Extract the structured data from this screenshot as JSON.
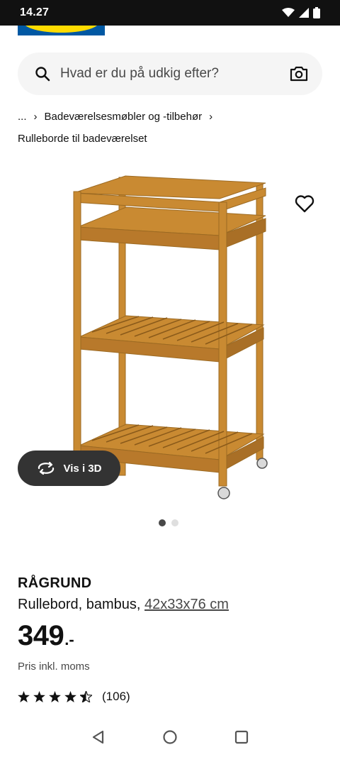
{
  "status_bar": {
    "time": "14.27"
  },
  "brand": {
    "blue": "#0058a3",
    "yellow": "#ffdb00"
  },
  "search": {
    "placeholder": "Hvad er du på udkig efter?"
  },
  "breadcrumb": {
    "ellipsis": "...",
    "category": "Badeværelsesmøbler og -tilbehør",
    "subcategory": "Rulleborde til badeværelset"
  },
  "gallery": {
    "button_3d": "Vis i 3D",
    "dots_total": 2,
    "dots_active": 1
  },
  "product": {
    "name": "RÅGRUND",
    "description": "Rullebord, bambus,",
    "dimensions": "42x33x76 cm",
    "price": "349",
    "price_suffix": ".-",
    "vat_note": "Pris inkl. moms",
    "rating": 4.5,
    "review_count": "(106)"
  },
  "icons": {
    "search": "search-icon",
    "camera": "camera-icon",
    "heart": "heart-icon",
    "rotate": "rotate-3d-icon",
    "back": "nav-back-icon",
    "home": "nav-home-icon",
    "recents": "nav-recents-icon"
  }
}
